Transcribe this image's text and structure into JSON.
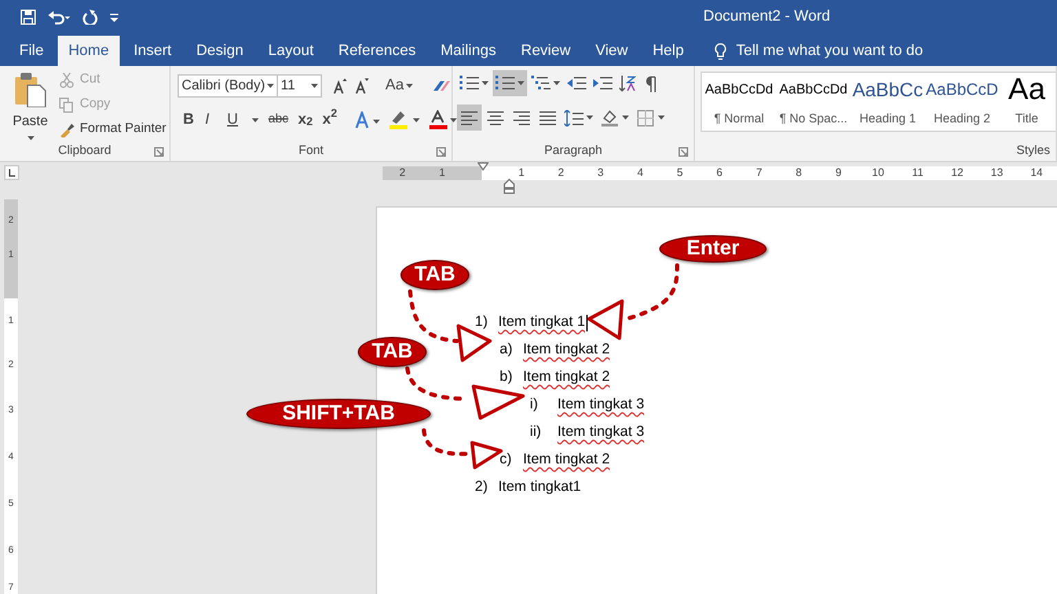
{
  "window": {
    "title": "Document2  -  Word"
  },
  "tabs": [
    {
      "label": "File",
      "selected": false
    },
    {
      "label": "Home",
      "selected": true
    },
    {
      "label": "Insert",
      "selected": false
    },
    {
      "label": "Design",
      "selected": false
    },
    {
      "label": "Layout",
      "selected": false
    },
    {
      "label": "References",
      "selected": false
    },
    {
      "label": "Mailings",
      "selected": false
    },
    {
      "label": "Review",
      "selected": false
    },
    {
      "label": "View",
      "selected": false
    },
    {
      "label": "Help",
      "selected": false
    }
  ],
  "tell_me": {
    "placeholder": "Tell me what you want to do"
  },
  "clipboard": {
    "paste": "Paste",
    "cut": "Cut",
    "copy": "Copy",
    "format_painter": "Format Painter",
    "label": "Clipboard"
  },
  "font": {
    "name": "Calibri (Body)",
    "size": "11",
    "change_case": "Aa",
    "label": "Font",
    "format_buttons": [
      "B",
      "I",
      "U",
      "abc",
      "x$_{2}$",
      "x$^{2}$"
    ]
  },
  "paragraph": {
    "label": "Paragraph",
    "numbering_selected": true,
    "align_left_selected": true
  },
  "styles": {
    "label": "Styles",
    "items": [
      {
        "preview": "AaBbCcDd",
        "name": "¶ Normal",
        "kind": "body"
      },
      {
        "preview": "AaBbCcDd",
        "name": "¶ No Spac...",
        "kind": "body"
      },
      {
        "preview": "AaBbCc",
        "name": "Heading 1",
        "kind": "heading1"
      },
      {
        "preview": "AaBbCcD",
        "name": "Heading 2",
        "kind": "heading2"
      },
      {
        "preview": "Aa",
        "name": "Title",
        "kind": "title"
      }
    ]
  },
  "ruler": {
    "left_labels": [
      "2",
      "1"
    ],
    "labels": [
      "1",
      "2",
      "3",
      "4",
      "5",
      "6",
      "7",
      "8",
      "9",
      "10",
      "11",
      "12",
      "13",
      "14"
    ]
  },
  "vertical_ruler": {
    "labels": [
      "2",
      "1",
      "1",
      "2",
      "3",
      "4",
      "5",
      "6",
      "7"
    ]
  },
  "document": {
    "list": [
      {
        "marker": "1)",
        "text": "Item tingkat 1",
        "flagged": true,
        "cursor": true,
        "children": [
          {
            "marker": "a)",
            "text": "Item tingkat 2",
            "flagged": true,
            "cursor": false
          },
          {
            "marker": "b)",
            "text": "Item tingkat 2",
            "flagged": true,
            "cursor": false,
            "children": [
              {
                "marker": "i)",
                "text": "Item tingkat 3",
                "flagged": true,
                "cursor": false
              },
              {
                "marker": "ii)",
                "text": "Item tingkat 3",
                "flagged": true,
                "cursor": false
              }
            ]
          },
          {
            "marker": "c)",
            "text": "Item tingkat 2",
            "flagged": true,
            "cursor": false
          }
        ]
      },
      {
        "marker": "2)",
        "text": "Item tingkat1",
        "flagged": false,
        "cursor": false
      }
    ]
  },
  "callouts": [
    {
      "label": "Enter"
    },
    {
      "label": "TAB"
    },
    {
      "label": "TAB"
    },
    {
      "label": "SHIFT+TAB"
    }
  ]
}
